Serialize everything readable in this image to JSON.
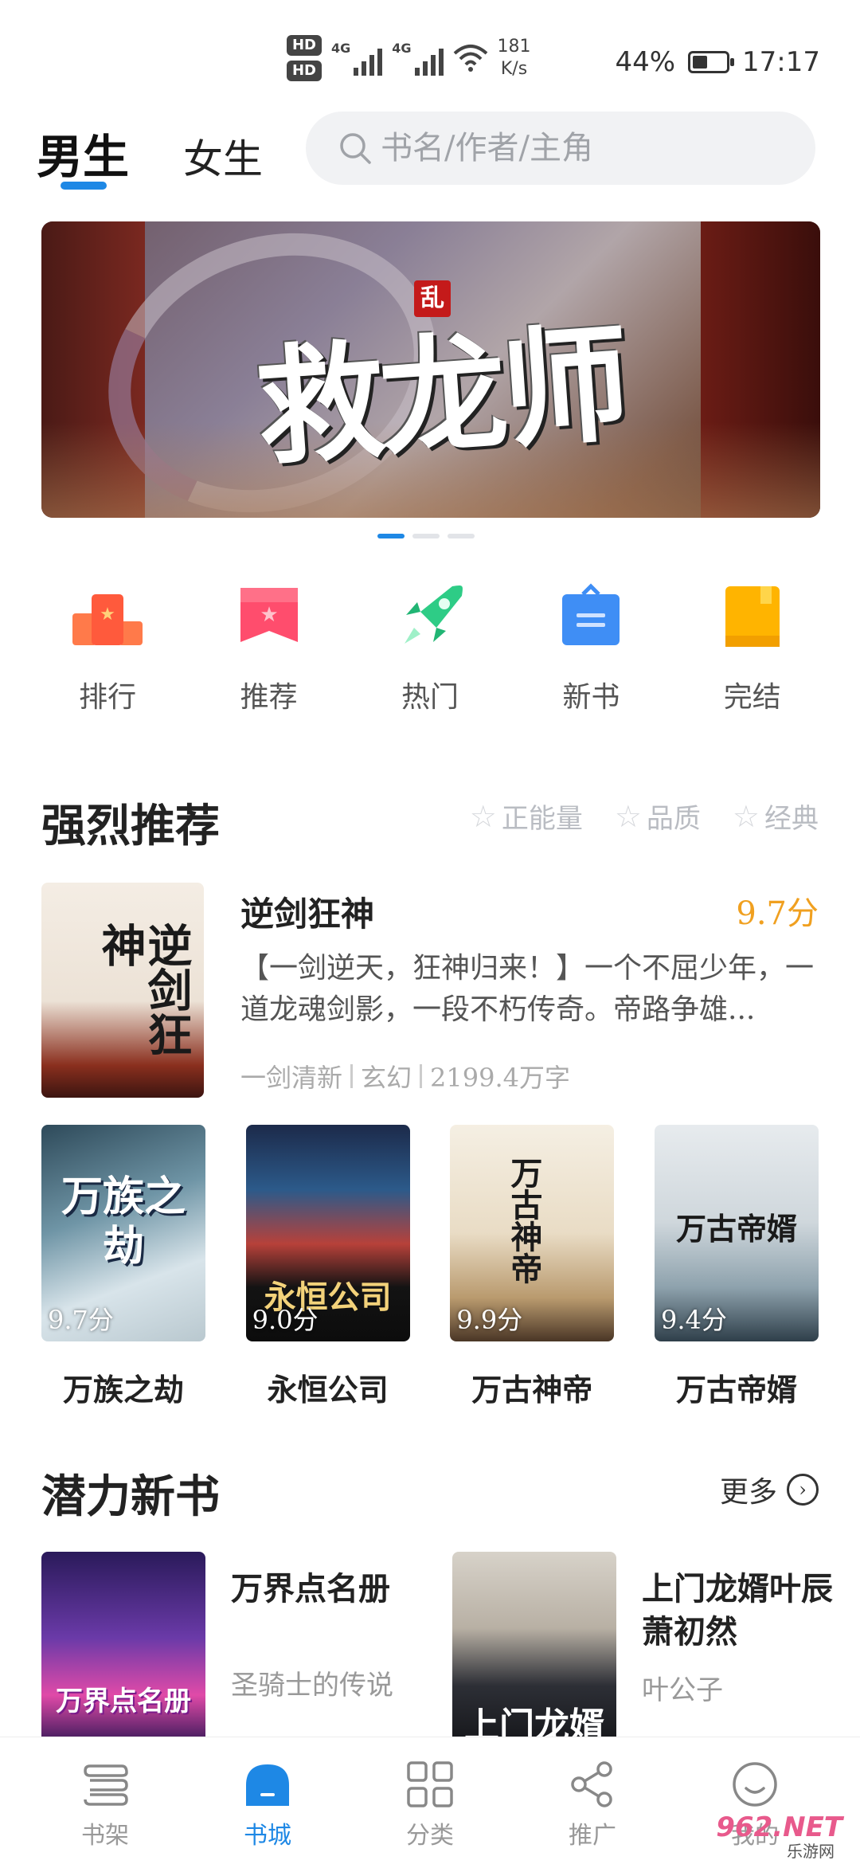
{
  "status_bar": {
    "hd1": "HD 1",
    "hd2": "HD 2",
    "net1": "4G",
    "net2": "4G",
    "speed_value": "181",
    "speed_unit": "K/s",
    "battery": "44%",
    "battery_level": 0.44,
    "time": "17:17"
  },
  "header": {
    "tab_male": "男生",
    "tab_female": "女生",
    "search_placeholder": "书名/作者/主角"
  },
  "banner": {
    "seal": "乱",
    "title": "救龙师",
    "page_count": 3,
    "active_page": 1
  },
  "categories": [
    {
      "label": "排行",
      "icon": "ranking-icon"
    },
    {
      "label": "推荐",
      "icon": "recommend-icon"
    },
    {
      "label": "热门",
      "icon": "rocket-icon"
    },
    {
      "label": "新书",
      "icon": "new-book-icon"
    },
    {
      "label": "完结",
      "icon": "finished-icon"
    }
  ],
  "strong_recommend": {
    "title": "强烈推荐",
    "tags": [
      "正能量",
      "品质",
      "经典"
    ],
    "featured": {
      "name": "逆剑狂神",
      "score": "9.7分",
      "cover_text": "逆剑狂神",
      "desc": "【一剑逆天，狂神归来！】一个不屈少年，一道龙魂剑影，一段不朽传奇。帝路争雄...",
      "author": "一剑清新",
      "genre": "玄幻",
      "words": "2199.4万字"
    },
    "books": [
      {
        "name": "万族之劫",
        "score": "9.7分",
        "cover_text": "万族之劫"
      },
      {
        "name": "永恒公司",
        "score": "9.0分",
        "cover_text": "永恒公司"
      },
      {
        "name": "万古神帝",
        "score": "9.9分",
        "cover_text": "万古神帝"
      },
      {
        "name": "万古帝婿",
        "score": "9.4分",
        "cover_text": "万古帝婿"
      }
    ]
  },
  "potential_new": {
    "title": "潜力新书",
    "more": "更多",
    "books": [
      {
        "name": "万界点名册",
        "author": "圣骑士的传说",
        "cover_text": "万界点名册"
      },
      {
        "name": "上门龙婿叶辰萧初然",
        "author": "叶公子",
        "cover_text": "上门龙婿"
      }
    ]
  },
  "bottom_nav": [
    {
      "label": "书架",
      "icon": "bookshelf-icon"
    },
    {
      "label": "书城",
      "icon": "bookstore-icon"
    },
    {
      "label": "分类",
      "icon": "category-grid-icon"
    },
    {
      "label": "推广",
      "icon": "share-icon"
    },
    {
      "label": "我的",
      "icon": "profile-icon"
    }
  ],
  "watermark": {
    "line1": "962.NET",
    "line2": "乐游网"
  },
  "colors": {
    "accent": "#1e88e5",
    "score": "#f0a020"
  }
}
